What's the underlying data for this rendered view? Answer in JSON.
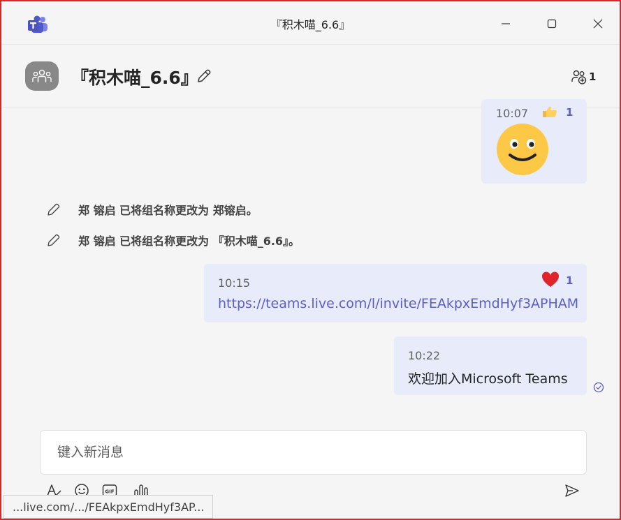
{
  "window": {
    "title": "『积木喵_6.6』"
  },
  "header": {
    "chat_title": "『积木喵_6.6』",
    "participant_count": "1"
  },
  "messages": [
    {
      "time": "10:07",
      "type": "emoji",
      "emoji": "slightly-smiling-face-icon",
      "reaction": {
        "icon": "thumbs-up-icon",
        "count": "1"
      }
    },
    {
      "time": "10:15",
      "type": "link",
      "text": "https://teams.live.com/l/invite/FEAkpxEmdHyf3APHAM",
      "reaction": {
        "icon": "heart-icon",
        "count": "1"
      }
    },
    {
      "time": "10:22",
      "type": "text",
      "text": "欢迎加入Microsoft Teams",
      "status_icon": "sent-check-icon"
    }
  ],
  "system_events": [
    {
      "text": "郑 镕启 已将组名称更改为 郑镕启。"
    },
    {
      "text": "郑 镕启 已将组名称更改为 『积木喵_6.6』。"
    }
  ],
  "compose": {
    "placeholder": "键入新消息"
  },
  "status_bar": {
    "url": "...live.com/.../FEAkpxEmdHyf3AP..."
  },
  "colors": {
    "accent": "#5b5fc7",
    "bubble": "#e8ebfa",
    "window_border": "#e0242c",
    "heart": "#e0242c"
  }
}
